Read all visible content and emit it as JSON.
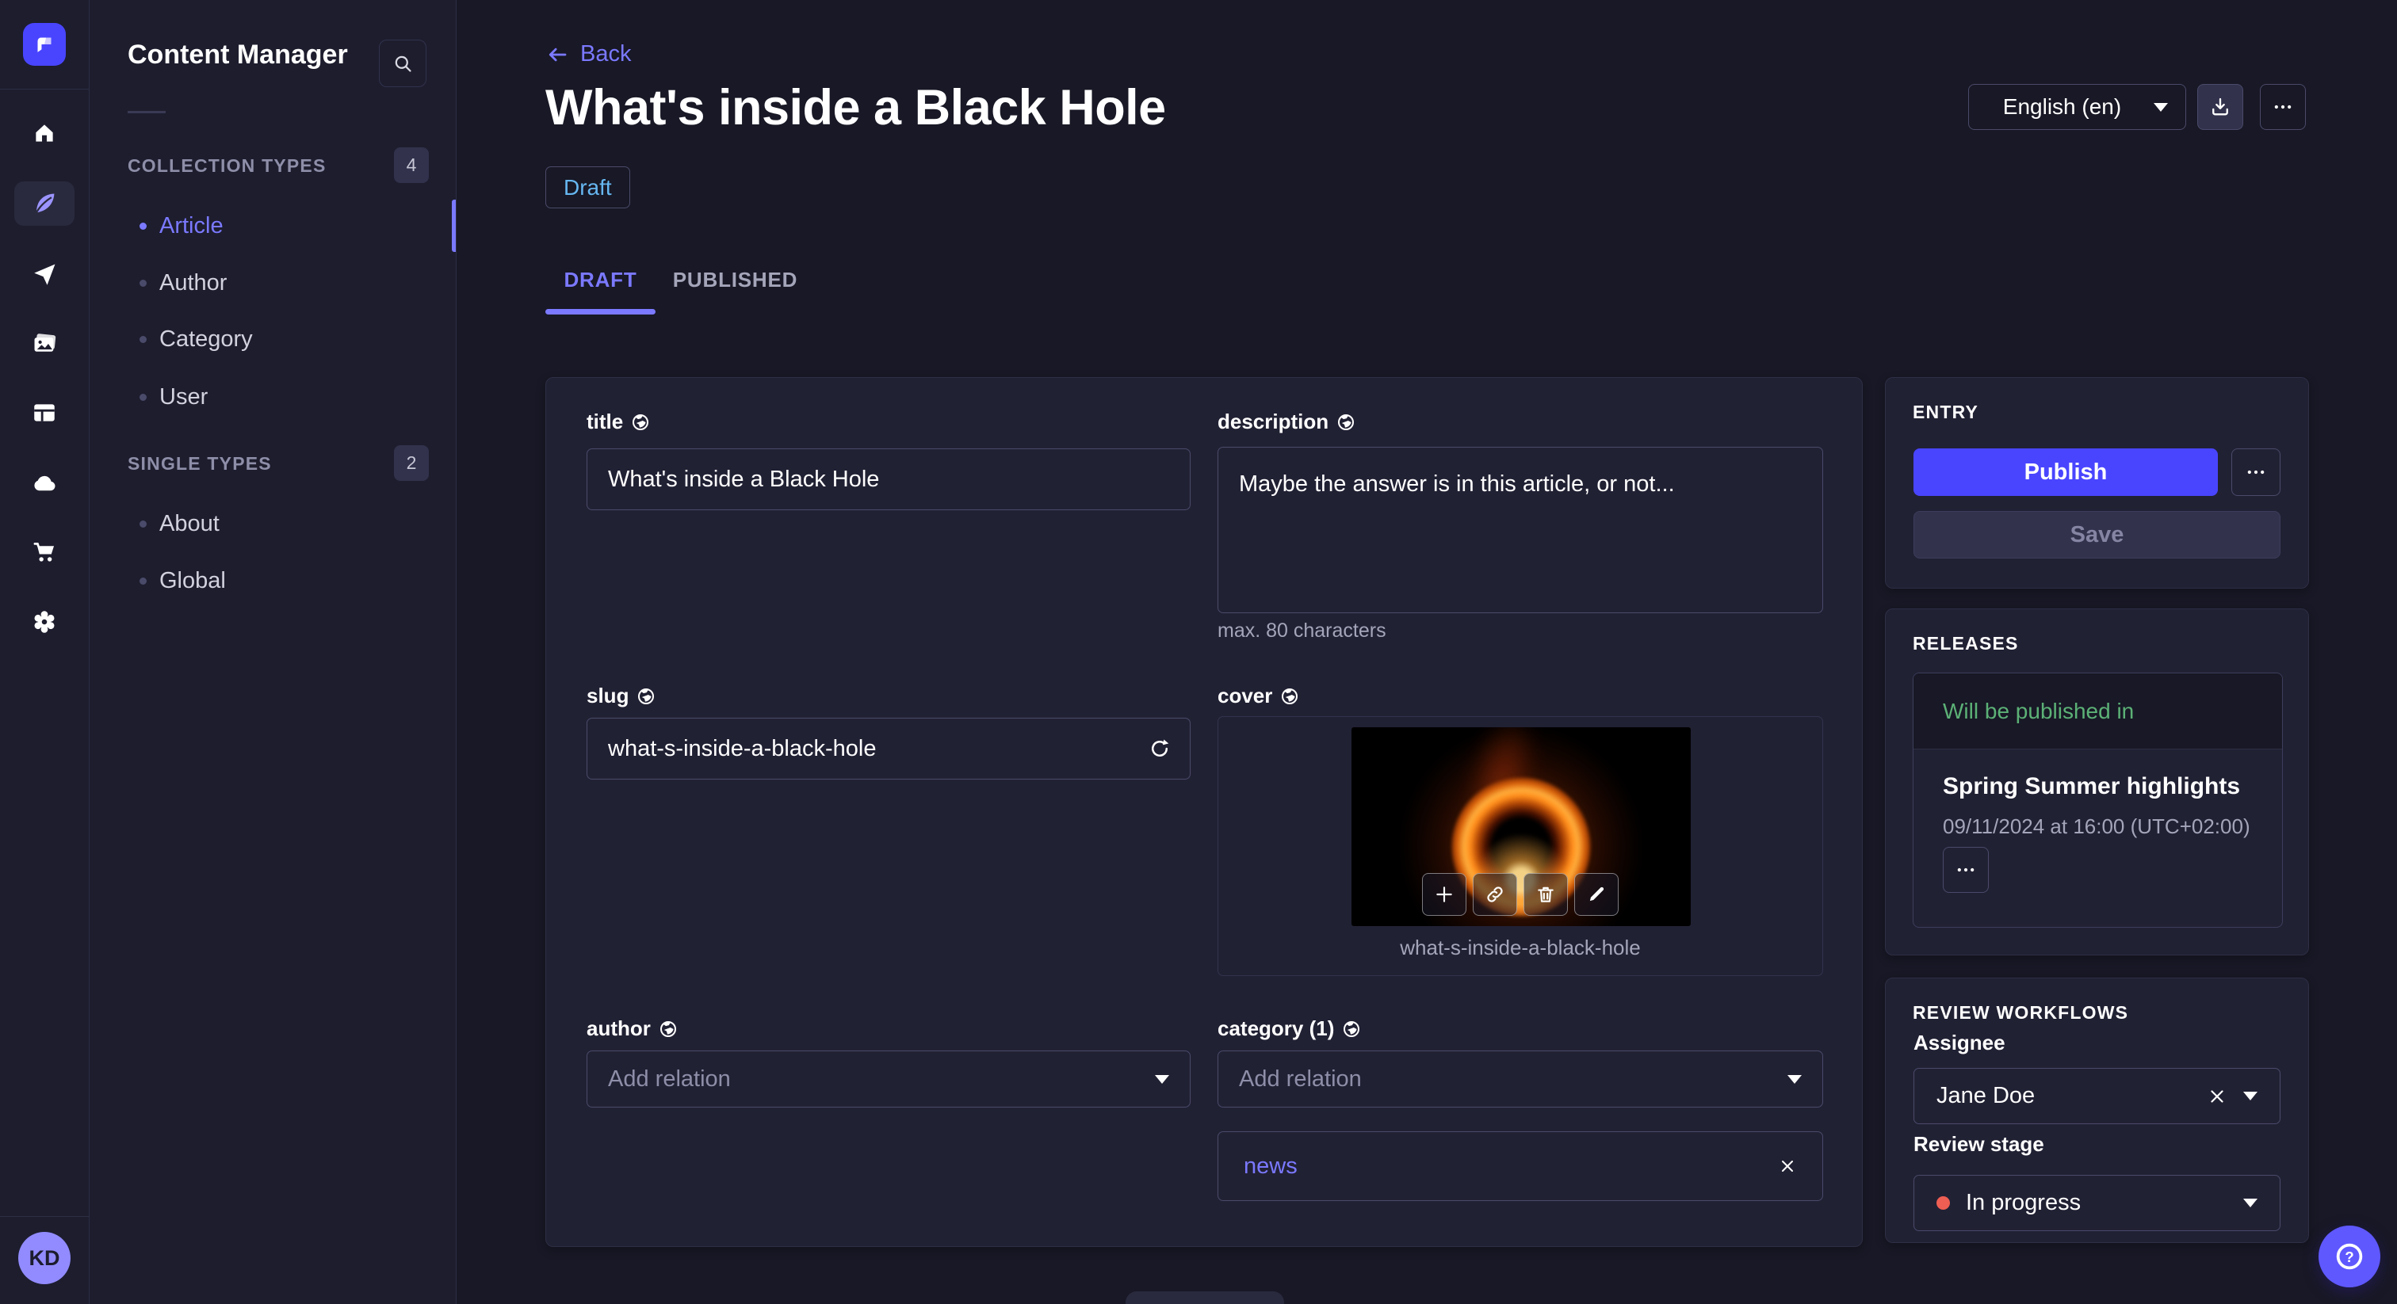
{
  "colors": {
    "page_bg": "#181826",
    "surface": "#212134",
    "accent": "#4945ff",
    "accent_light": "#7b79ff",
    "draft_blue": "#66b7f1",
    "success_green": "#5cb176",
    "danger_red": "#ee5e52"
  },
  "app": {
    "avatar_initials": "KD"
  },
  "subnav": {
    "title": "Content Manager",
    "sections": [
      {
        "label": "COLLECTION TYPES",
        "count": "4",
        "items": [
          {
            "label": "Article"
          },
          {
            "label": "Author"
          },
          {
            "label": "Category"
          },
          {
            "label": "User"
          }
        ]
      },
      {
        "label": "SINGLE TYPES",
        "count": "2",
        "items": [
          {
            "label": "About"
          },
          {
            "label": "Global"
          }
        ]
      }
    ]
  },
  "header": {
    "back_label": "Back",
    "title": "What's inside a Black Hole",
    "status_badge": "Draft",
    "tabs": [
      {
        "label": "DRAFT"
      },
      {
        "label": "PUBLISHED"
      }
    ],
    "locale_selected": "English (en)"
  },
  "form": {
    "title": {
      "label": "title",
      "value": "What's inside a Black Hole"
    },
    "description": {
      "label": "description",
      "value": "Maybe the answer is in this article, or not...",
      "hint": "max. 80 characters"
    },
    "slug": {
      "label": "slug",
      "value": "what-s-inside-a-black-hole"
    },
    "cover": {
      "label": "cover",
      "filename": "what-s-inside-a-black-hole"
    },
    "author": {
      "label": "author",
      "placeholder": "Add relation"
    },
    "category": {
      "label": "category (1)",
      "placeholder": "Add relation",
      "relations": [
        {
          "label": "news"
        }
      ]
    }
  },
  "entry": {
    "heading": "ENTRY",
    "publish_label": "Publish",
    "save_label": "Save"
  },
  "releases": {
    "heading": "RELEASES",
    "banner": "Will be published in",
    "release_name": "Spring Summer highlights",
    "release_date": "09/11/2024 at 16:00 (UTC+02:00)"
  },
  "review": {
    "heading": "REVIEW WORKFLOWS",
    "assignee_label": "Assignee",
    "assignee_value": "Jane Doe",
    "stage_label": "Review stage",
    "stage_value": "In progress"
  },
  "icons": {
    "search-icon": "🔍",
    "home-icon": "⌂",
    "feather-icon": "✒",
    "send-icon": "➤",
    "media-icon": "🖼",
    "layout-icon": "▦",
    "cloud-icon": "☁",
    "cart-icon": "🛒",
    "gear-icon": "⚙",
    "globe-icon": "🌐",
    "download-icon": "⭳",
    "more-icon": "⋯",
    "back-arrow-icon": "←",
    "refresh-icon": "↻",
    "plus-icon": "+",
    "link-icon": "🔗",
    "trash-icon": "🗑",
    "edit-icon": "✎",
    "close-icon": "✕",
    "caret-down-icon": "▾",
    "help-icon": "?"
  }
}
